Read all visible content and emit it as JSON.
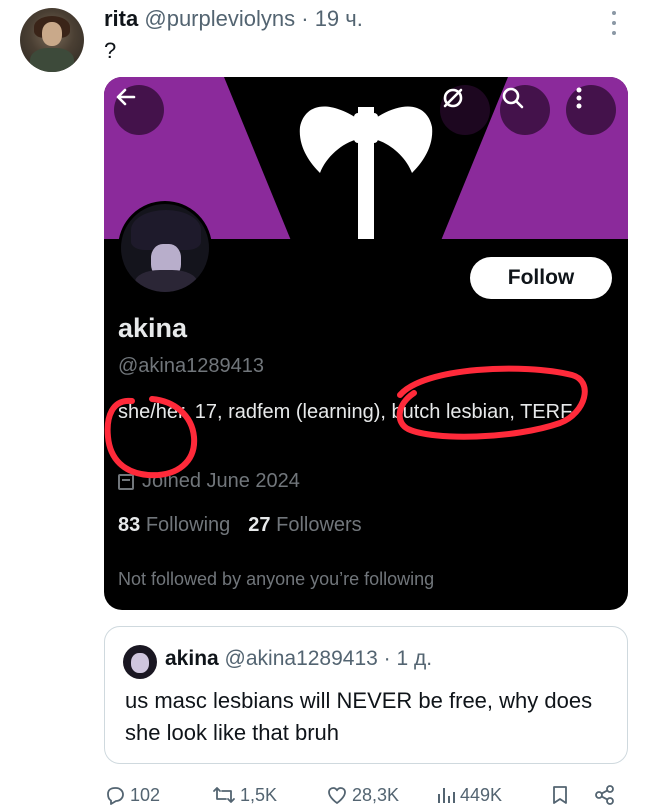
{
  "tweet": {
    "display_name": "rita",
    "handle": "@purpleviolyns",
    "separator": "·",
    "time": "19 ч.",
    "text": "?"
  },
  "profile_card": {
    "follow_label": "Follow",
    "name": "akina",
    "handle": "@akina1289413",
    "bio": "she/her, 17, radfem (learning), butch lesbian, TERF",
    "joined": "Joined June 2024",
    "following_count": "83",
    "following_label": "Following",
    "followers_count": "27",
    "followers_label": "Followers",
    "note": "Not followed by anyone you’re following",
    "banner_color": "#8b2a9b",
    "annotation_color": "#ff2a3a"
  },
  "quote": {
    "name": "akina",
    "handle": "@akina1289413",
    "separator": "·",
    "time": "1 д.",
    "text": "us masc lesbians will NEVER be free, why does she look like that bruh"
  },
  "actions": {
    "replies": "102",
    "reposts": "1,5K",
    "likes": "28,3K",
    "views": "449K"
  },
  "icons": [
    "back-arrow-icon",
    "mute-icon",
    "search-icon",
    "more-icon",
    "calendar-icon",
    "reply-icon",
    "repost-icon",
    "like-icon",
    "views-icon",
    "bookmark-icon",
    "share-icon"
  ]
}
